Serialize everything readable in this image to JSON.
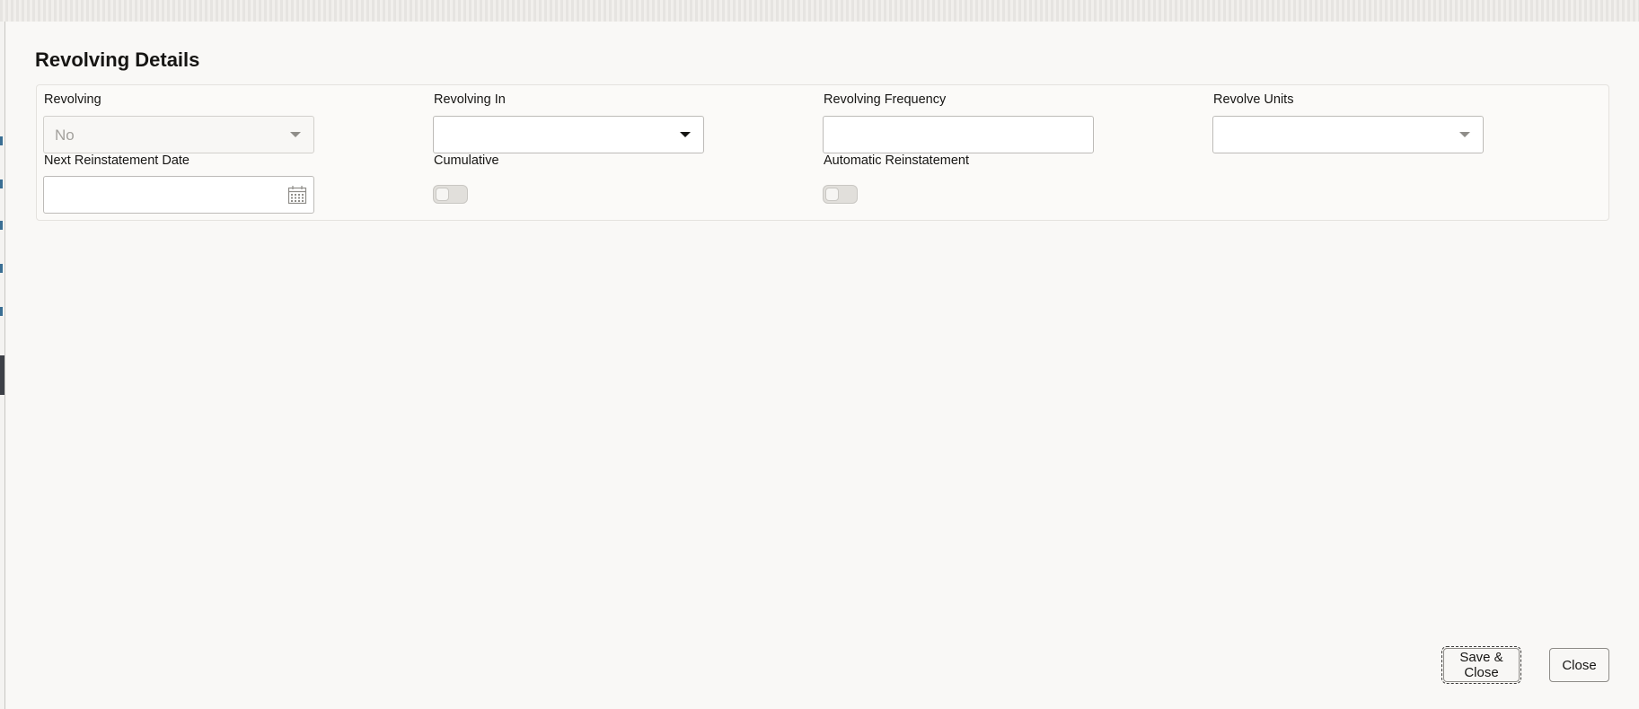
{
  "dialog": {
    "title": "Revolving Details"
  },
  "form": {
    "revolving": {
      "label": "Revolving",
      "value": "No"
    },
    "revolving_in": {
      "label": "Revolving In",
      "value": ""
    },
    "revolving_frequency": {
      "label": "Revolving Frequency",
      "value": ""
    },
    "revolve_units": {
      "label": "Revolve Units",
      "value": ""
    },
    "next_reinstatement_date": {
      "label": "Next Reinstatement Date",
      "value": ""
    },
    "cumulative": {
      "label": "Cumulative",
      "state": "off"
    },
    "automatic_reinstatement": {
      "label": "Automatic Reinstatement",
      "state": "off"
    }
  },
  "footer": {
    "save_close_label": "Save & Close",
    "close_label": "Close"
  },
  "colors": {
    "dialog_background": "#f9f8f6",
    "text": "#161513",
    "disabled_text": "#a3a19d",
    "border": "#bdbbb8"
  }
}
